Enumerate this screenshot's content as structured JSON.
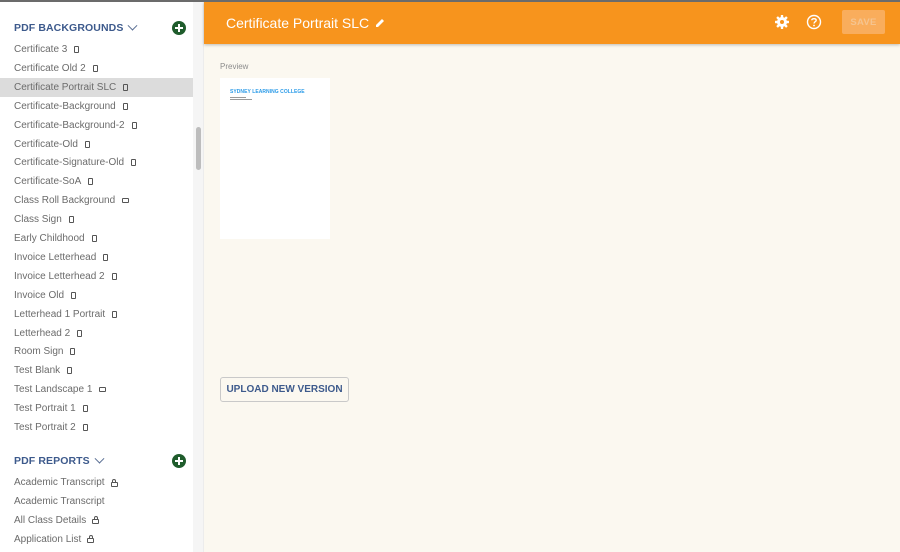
{
  "header": {
    "title": "Certificate Portrait SLC",
    "save_label": "SAVE",
    "edit_icon": "pencil-icon",
    "settings_icon": "gear-icon",
    "help_icon": "help-icon",
    "accent_color": "#f7941d"
  },
  "sidebar": {
    "sections": [
      {
        "title": "PDF BACKGROUNDS",
        "items": [
          {
            "label": "Certificate 3",
            "icon": "portrait"
          },
          {
            "label": "Certificate Old 2",
            "icon": "portrait"
          },
          {
            "label": "Certificate Portrait SLC",
            "icon": "portrait",
            "selected": true
          },
          {
            "label": "Certificate-Background",
            "icon": "portrait"
          },
          {
            "label": "Certificate-Background-2",
            "icon": "portrait"
          },
          {
            "label": "Certificate-Old",
            "icon": "portrait"
          },
          {
            "label": "Certificate-Signature-Old",
            "icon": "portrait"
          },
          {
            "label": "Certificate-SoA",
            "icon": "portrait"
          },
          {
            "label": "Class Roll Background",
            "icon": "landscape"
          },
          {
            "label": "Class Sign",
            "icon": "portrait"
          },
          {
            "label": "Early Childhood",
            "icon": "portrait"
          },
          {
            "label": "Invoice Letterhead",
            "icon": "portrait"
          },
          {
            "label": "Invoice Letterhead 2",
            "icon": "portrait"
          },
          {
            "label": "Invoice Old",
            "icon": "portrait"
          },
          {
            "label": "Letterhead 1 Portrait",
            "icon": "portrait"
          },
          {
            "label": "Letterhead 2",
            "icon": "portrait"
          },
          {
            "label": "Room Sign",
            "icon": "portrait"
          },
          {
            "label": "Test Blank",
            "icon": "portrait"
          },
          {
            "label": "Test Landscape 1",
            "icon": "landscape"
          },
          {
            "label": "Test Portrait 1",
            "icon": "portrait"
          },
          {
            "label": "Test Portrait 2",
            "icon": "portrait"
          }
        ]
      },
      {
        "title": "PDF REPORTS",
        "items": [
          {
            "label": "Academic Transcript",
            "icon": "lock"
          },
          {
            "label": "Academic Transcript",
            "icon": "none"
          },
          {
            "label": "All Class Details",
            "icon": "lock"
          },
          {
            "label": "Application List",
            "icon": "lock"
          }
        ]
      }
    ]
  },
  "main": {
    "preview_label": "Preview",
    "preview_document_title": "SYDNEY LEARNING COLLEGE",
    "upload_label": "UPLOAD NEW VERSION"
  }
}
